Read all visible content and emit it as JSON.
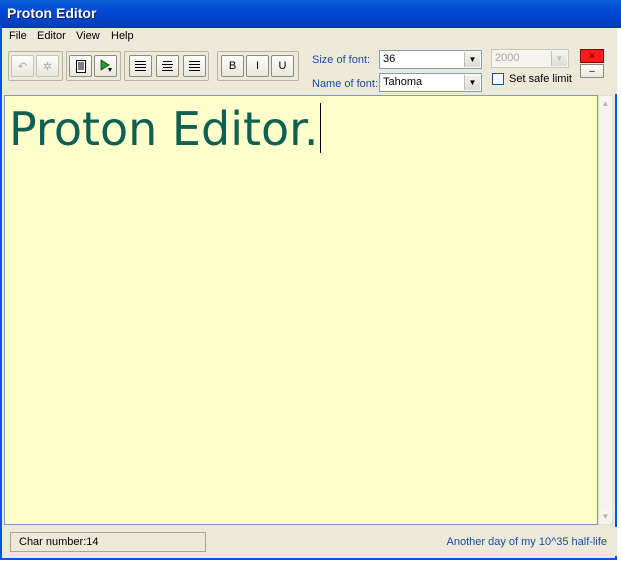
{
  "window": {
    "title": "Proton Editor"
  },
  "menu": {
    "items": [
      "File",
      "Editor",
      "View",
      "Help"
    ]
  },
  "toolbar": {
    "icons": {
      "undo": "undo-icon",
      "redo": "redo-icon",
      "new": "new-document-icon",
      "run": "run-icon",
      "align_left": "align-left-icon",
      "align_center": "align-center-icon",
      "align_right": "align-right-icon"
    },
    "bold": "B",
    "italic": "I",
    "underline": "U",
    "font_size_label": "Size of font:",
    "font_size_value": "36",
    "font_name_label": "Name of font:",
    "font_name_value": "Tahoma",
    "limit_value": "2000",
    "safe_limit_label": "Set safe limit",
    "safe_limit_checked": false,
    "close_glyph": "✕",
    "minimize_glyph": "–"
  },
  "editor": {
    "text": "Proton Editor.",
    "background": "#ffffcc",
    "text_color": "#0f5f52"
  },
  "status": {
    "char_number": "Char number:14",
    "tagline": "Another day of my 10^35 half-life"
  }
}
